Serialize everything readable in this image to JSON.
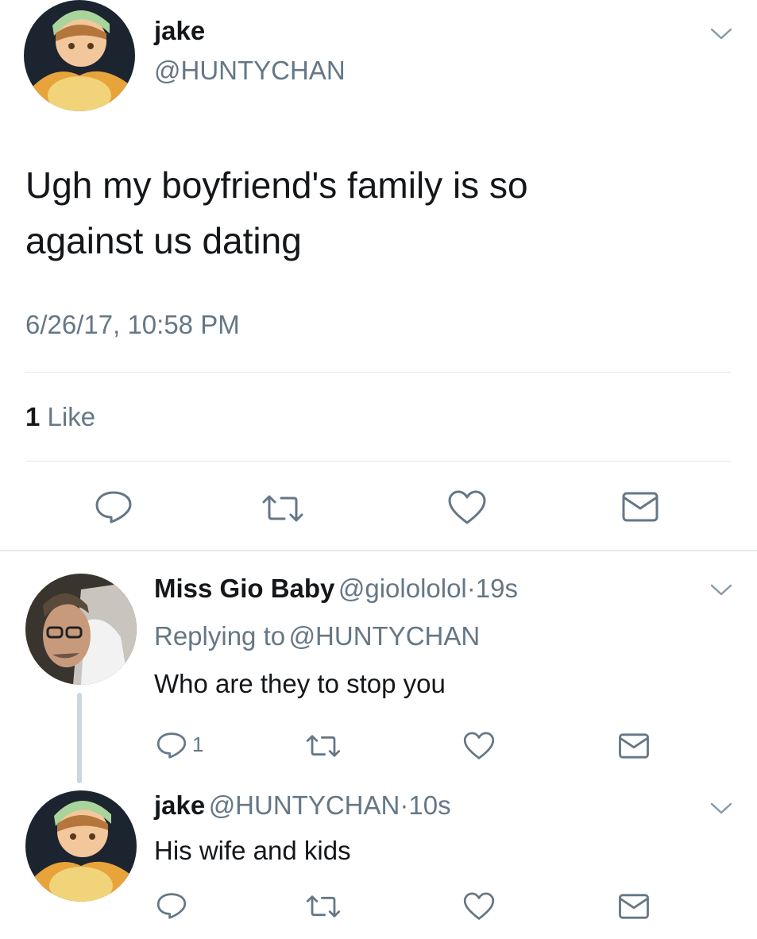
{
  "main_tweet": {
    "name": "jake",
    "handle": "@HUNTYCHAN",
    "text_line1": "Ugh my boyfriend's family is so",
    "text_line2": "against us dating",
    "timestamp": "6/26/17, 10:58 PM",
    "likes_count": "1",
    "likes_label": "Like"
  },
  "replies": [
    {
      "name": "Miss Gio Baby",
      "handle": "@giolololol",
      "separator": "·",
      "time": "19s",
      "replying_prefix": "Replying to",
      "replying_handle": "@HUNTYCHAN",
      "text": "Who are they to stop you",
      "reply_count": "1"
    },
    {
      "name": "jake",
      "handle": "@HUNTYCHAN",
      "separator": "·",
      "time": "10s",
      "text": "His wife and kids"
    }
  ],
  "icons": [
    "chevron-down-icon",
    "reply-icon",
    "retweet-icon",
    "like-icon",
    "message-icon"
  ],
  "colors": {
    "text": "#14171a",
    "secondary": "#657786",
    "link": "#1b95e0",
    "divider": "#e1e8ed"
  }
}
